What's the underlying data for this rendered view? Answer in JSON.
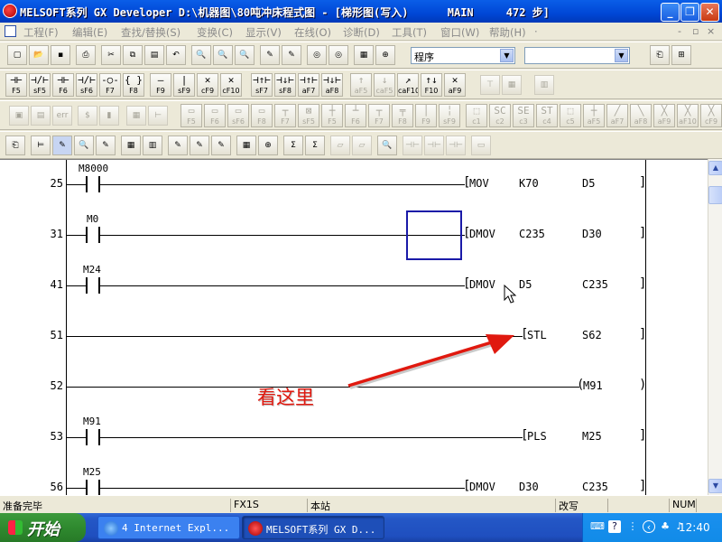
{
  "window": {
    "title": "MELSOFT系列 GX Developer D:\\机器图\\80吨冲床程式图 - [梯形图(写入)      MAIN     472 步]",
    "minimize": "_",
    "restore": "❐",
    "close": "✕"
  },
  "menu": {
    "items": [
      "工程(F)",
      "编辑(E)",
      "查找/替换(S)",
      "变换(C)",
      "显示(V)",
      "在线(O)",
      "诊断(D)",
      "工具(T)",
      "窗口(W)",
      "帮助(H)"
    ],
    "more": "·",
    "mdi_min": "-",
    "mdi_restore": "▫",
    "mdi_close": "×"
  },
  "toolbar": {
    "program_combo": "程序",
    "second_combo": ""
  },
  "ladder_keys": [
    {
      "sym": "⊣⊢",
      "key": "F5"
    },
    {
      "sym": "⊣/⊢",
      "key": "sF5"
    },
    {
      "sym": "⊣⊢",
      "key": "F6"
    },
    {
      "sym": "⊣/⊢",
      "key": "sF6"
    },
    {
      "sym": "-○-",
      "key": "F7"
    },
    {
      "sym": "{ }",
      "key": "F8"
    },
    {
      "sym": "—",
      "key": "F9"
    },
    {
      "sym": "|",
      "key": "sF9"
    },
    {
      "sym": "✕",
      "key": "cF9"
    },
    {
      "sym": "✕",
      "key": "cF10"
    },
    {
      "sym": "⊣↑⊢",
      "key": "sF7"
    },
    {
      "sym": "⊣↓⊢",
      "key": "sF8"
    },
    {
      "sym": "⊣↑⊢",
      "key": "aF7"
    },
    {
      "sym": "⊣↓⊢",
      "key": "aF8"
    },
    {
      "sym": "↑",
      "key": "aF5"
    },
    {
      "sym": "↓",
      "key": "caF5"
    },
    {
      "sym": "↗",
      "key": "caF10"
    },
    {
      "sym": "↑↓",
      "key": "F10"
    },
    {
      "sym": "✕",
      "key": "aF9"
    }
  ],
  "sfc_keys": [
    "F5",
    "F6",
    "sF6",
    "F8",
    "F7",
    "sF5",
    "F5",
    "F6",
    "F7",
    "F8",
    "F9",
    "sF9",
    "c1",
    "c2",
    "c3",
    "c4",
    "c5",
    "aF5",
    "aF7",
    "aF8",
    "aF9",
    "aF10",
    "cF9"
  ],
  "ladder": {
    "rungs": [
      {
        "step": "25",
        "contact": "M8000",
        "ins": "MOV",
        "op1": "K70",
        "op2": "D5"
      },
      {
        "step": "31",
        "contact": "M0",
        "ins": "DMOV",
        "op1": "C235",
        "op2": "D30"
      },
      {
        "step": "41",
        "contact": "M24",
        "ins": "DMOV",
        "op1": "D5",
        "op2": "C235"
      },
      {
        "step": "51",
        "contact": "",
        "ins": "STL",
        "op1": "S62",
        "op2": ""
      },
      {
        "step": "52",
        "contact": "",
        "ins": "M91",
        "op1": "",
        "op2": ""
      },
      {
        "step": "53",
        "contact": "M91",
        "ins": "PLS",
        "op1": "M25",
        "op2": ""
      },
      {
        "step": "56",
        "contact": "M25",
        "ins": "DMOV",
        "op1": "D30",
        "op2": "C235"
      }
    ],
    "annotation": "看这里"
  },
  "status": {
    "ready": "准备完毕",
    "plc": "FX1S",
    "station": "本站",
    "mode": "改写",
    "numlock": "NUM"
  },
  "taskbar": {
    "start": "开始",
    "tasks": [
      "4 Internet Expl...",
      "MELSOFT系列 GX D..."
    ],
    "clock": "12:40"
  },
  "colors": {
    "titlebar": "#0a5ee8",
    "annotation": "#e0190f",
    "cursor": "#1a1aa8"
  }
}
